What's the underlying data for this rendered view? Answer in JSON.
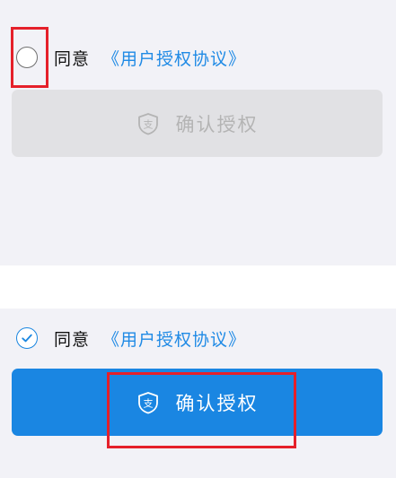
{
  "state_unchecked": {
    "agree_text": "同意",
    "agreement_link": "《用户授权协议》",
    "confirm_label": "确认授权",
    "radio_checked": false,
    "button_enabled": false
  },
  "state_checked": {
    "agree_text": "同意",
    "agreement_link": "《用户授权协议》",
    "confirm_label": "确认授权",
    "radio_checked": true,
    "button_enabled": true
  },
  "colors": {
    "panel_background": "#f2f2f7",
    "link": "#1f8ae5",
    "button_enabled": "#1a86e2",
    "button_disabled": "#e1e1e4",
    "button_disabled_text": "#b4b4b4",
    "highlight": "#e5202a"
  },
  "icons": {
    "radio_unchecked": "circle-icon",
    "radio_checked": "check-circle-icon",
    "button_icon": "alipay-shield-icon"
  }
}
